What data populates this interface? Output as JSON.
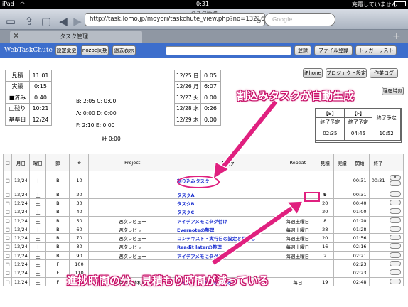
{
  "status": {
    "carrier": "iPad",
    "wifi": "wifi-icon",
    "time": "0:31",
    "charge": "充電していません"
  },
  "browser": {
    "title": "タスク管理",
    "url": "http://task.lomo.jp/moyori/taskchute_view.php?no=132164…",
    "search_placeholder": "Google",
    "tab_title": "タスク管理"
  },
  "app": {
    "logo": "WebTaskChute",
    "buttons": [
      "設定変更",
      "nozbe同期",
      "過去表示"
    ],
    "right_buttons": [
      "登録",
      "ファイル登録",
      "トリガーリスト"
    ],
    "row2_buttons": [
      "iPhone",
      "プロジェクト設定",
      "作業ログ"
    ],
    "extra_button": "理在時刻"
  },
  "plan": [
    {
      "label": "見積",
      "value": "11:01"
    },
    {
      "label": "実績",
      "value": "0:15"
    },
    {
      "label": "■済み",
      "value": "0:40"
    },
    {
      "label": "□残り",
      "value": "10:21"
    },
    {
      "label": "基準日",
      "value": "12/24"
    }
  ],
  "stats": {
    "b": "B:  2:05  C:   0:00",
    "a": "A:  0:00  D:   0:00",
    "f": "F:  2:10  E:   0:00",
    "total": "計    0:00"
  },
  "week": [
    {
      "d": "12/25 日",
      "t": "0:05"
    },
    {
      "d": "12/26 月",
      "t": "6:07"
    },
    {
      "d": "12/27 火",
      "t": "0:00"
    },
    {
      "d": "12/28 水",
      "t": "0:26"
    },
    {
      "d": "12/29 木",
      "t": "0:00"
    }
  ],
  "endbox": {
    "headers": [
      "【B】",
      "【F】"
    ],
    "labels": [
      "終了予定",
      "終了予定",
      "終了予定"
    ],
    "values": [
      "02:35",
      "04:45",
      "10:52"
    ]
  },
  "table": {
    "headers": [
      "□",
      "月日",
      "曜日",
      "節",
      "#",
      "Project",
      "タスク",
      "Repeat",
      "見積",
      "実績",
      "開始",
      "終了",
      ""
    ],
    "rows": [
      [
        "□",
        "12/24",
        "土",
        "B",
        "10",
        "",
        "割り込みタスク",
        "",
        "",
        "",
        "00:31",
        "00:31",
        "x"
      ],
      [
        "□",
        "12/24",
        "土",
        "B",
        "20",
        "",
        "タスクA",
        "",
        "9",
        "",
        "00:31",
        "",
        ""
      ],
      [
        "□",
        "12/24",
        "土",
        "B",
        "30",
        "",
        "タスクB",
        "",
        "20",
        "",
        "00:40",
        "",
        ""
      ],
      [
        "□",
        "12/24",
        "土",
        "B",
        "40",
        "",
        "タスクC",
        "",
        "20",
        "",
        "01:00",
        "",
        ""
      ],
      [
        "□",
        "12/24",
        "土",
        "B",
        "50",
        "週次レビュー",
        "アイデアメモにタグ付け",
        "毎週土曜日",
        "8",
        "",
        "01:20",
        "",
        ""
      ],
      [
        "□",
        "12/24",
        "土",
        "B",
        "60",
        "週次レビュー",
        "Evernoteの整理",
        "毎週土曜日",
        "28",
        "",
        "01:28",
        "",
        ""
      ],
      [
        "□",
        "12/24",
        "土",
        "B",
        "70",
        "週次レビュー",
        "コンテキスト・実行日の設定と見直し",
        "毎週土曜日",
        "20",
        "",
        "01:56",
        "",
        ""
      ],
      [
        "□",
        "12/24",
        "土",
        "B",
        "80",
        "週次レビュー",
        "Readit laterの整理",
        "毎週土曜日",
        "16",
        "",
        "02:16",
        "",
        ""
      ],
      [
        "□",
        "12/24",
        "土",
        "B",
        "90",
        "週次レビュー",
        "アイデアメモにタグ付け",
        "毎週土曜日",
        "2",
        "",
        "02:21",
        "",
        ""
      ],
      [
        "□",
        "12/24",
        "土",
        "F",
        "100",
        "",
        "",
        "",
        "",
        "",
        "02:23",
        "",
        ""
      ],
      [
        "□",
        "12/24",
        "土",
        "F",
        "110",
        "",
        "",
        "",
        "",
        "",
        "02:23",
        "",
        ""
      ],
      [
        "□",
        "12/24",
        "土",
        "F",
        "120",
        "時間有効利用",
        "アイデアメモを顧らませる",
        "毎日",
        "19",
        "",
        "02:48",
        "",
        ""
      ]
    ]
  },
  "annotations": {
    "top": "割込みタスクが自動生成",
    "bottom": "進捗時間の分、見積もり時間が減っている"
  }
}
